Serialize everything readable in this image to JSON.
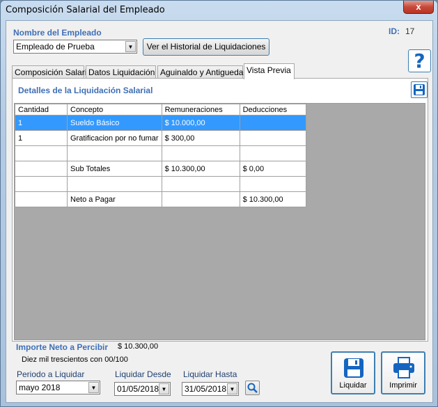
{
  "window": {
    "title": "Composición Salarial del Empleado",
    "close_glyph": "x"
  },
  "employee": {
    "label": "Nombre del Empleado",
    "selected": "Empleado de Prueba",
    "history_button": "Ver el Historial de Liquidaciones",
    "id_label": "ID:",
    "id_value": "17"
  },
  "help": {
    "glyph": "?"
  },
  "tabs": [
    {
      "label": "Composición Salarial"
    },
    {
      "label": "Datos Liquidación"
    },
    {
      "label": "Aguinaldo y Antiguedad"
    },
    {
      "label": "Vista Previa"
    }
  ],
  "panel": {
    "title": "Detalles de la Liquidación Salarial",
    "columns": [
      "Cantidad",
      "Concepto",
      "Remuneraciones",
      "Deducciones"
    ],
    "rows": [
      [
        "1",
        "Sueldo Básico",
        "$ 10.000,00",
        ""
      ],
      [
        "1",
        "Gratificacion por no fumar",
        "$ 300,00",
        ""
      ],
      [
        "",
        "",
        "",
        ""
      ],
      [
        "",
        "Sub Totales",
        "$ 10.300,00",
        "$ 0,00"
      ],
      [
        "",
        "",
        "",
        ""
      ],
      [
        "",
        "Neto a Pagar",
        "",
        "$ 10.300,00"
      ]
    ]
  },
  "footer": {
    "net_label": "Importe Neto a Percibir",
    "net_value": "$ 10.300,00",
    "net_words": "Diez mil trescientos con 00/100",
    "period_label": "Periodo a Liquidar",
    "period_value": "mayo 2018",
    "from_label": "Liquidar Desde",
    "from_value": "01/05/2018",
    "to_label": "Liquidar Hasta",
    "to_value": "31/05/2018",
    "liquidar_button": "Liquidar",
    "print_button": "Imprimir"
  },
  "colors": {
    "accent": "#3f6fb6",
    "selection": "#3399ff",
    "grid_bg": "#a9a9a9"
  },
  "icons": [
    "close-icon",
    "dropdown-arrow-icon",
    "help-icon",
    "save-icon",
    "search-icon",
    "printer-icon"
  ]
}
